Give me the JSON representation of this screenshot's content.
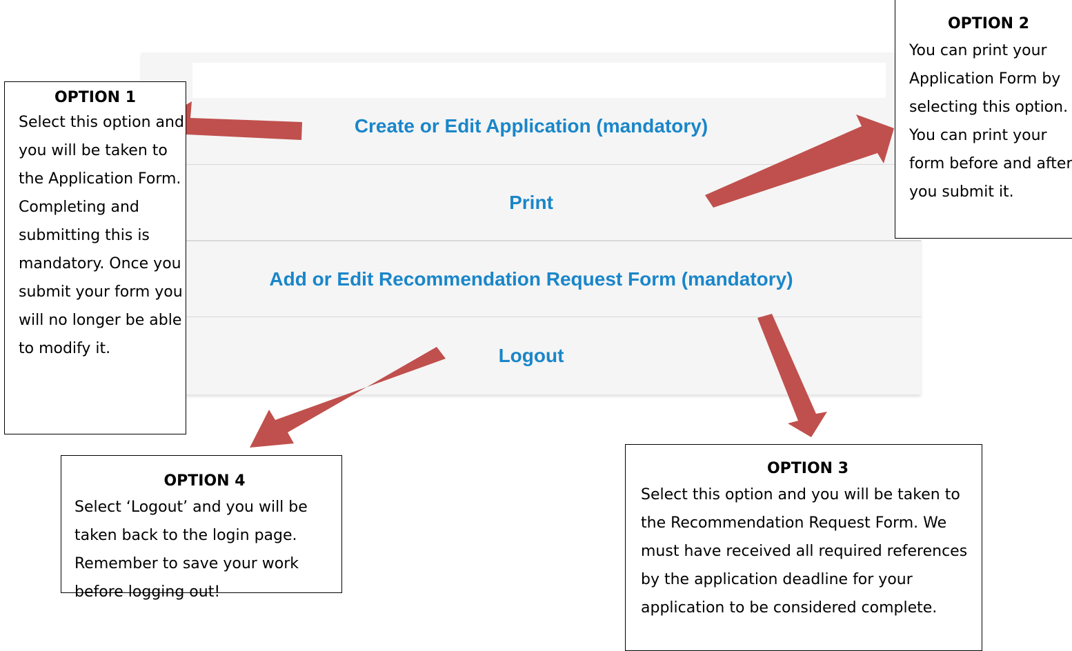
{
  "menu": {
    "create_edit_label": "Create or Edit Application (mandatory)",
    "print_label": "Print",
    "recommendation_label": "Add or Edit Recommendation Request Form (mandatory)",
    "logout_label": "Logout"
  },
  "callouts": {
    "option1": {
      "title": "OPTION 1",
      "text": "Select this option and you will be taken to the Application Form. Completing and submitting this is mandatory. Once you submit your form you will no longer be able to modify it."
    },
    "option2": {
      "title": "OPTION 2",
      "text": "You can print your Application Form by selecting this option. You can print your form before and after you submit it."
    },
    "option3": {
      "title": "OPTION 3",
      "text": "Select this option and you will be taken to the Recommendation Request Form. We must have received all required references by the application deadline for your application to be considered complete."
    },
    "option4": {
      "title": "OPTION 4",
      "text": "Select ‘Logout’ and you will be taken back to the login page. Remember to save your work before logging out!"
    }
  },
  "colors": {
    "link_blue": "#1a86c9",
    "arrow_red": "#c0504d",
    "panel_gray": "#f5f5f5"
  }
}
